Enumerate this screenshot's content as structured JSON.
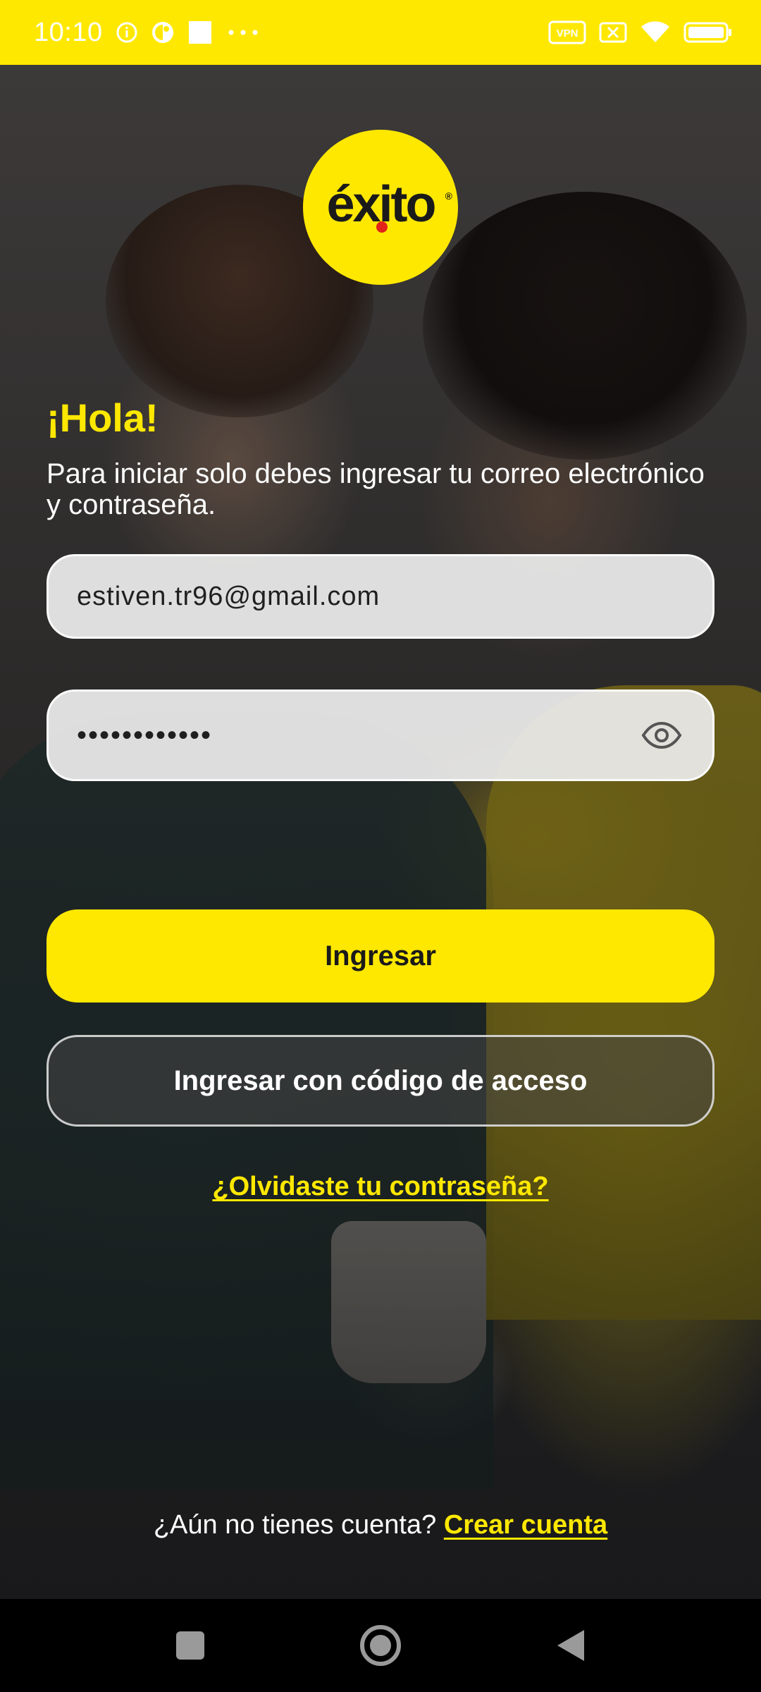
{
  "status_bar": {
    "time": "10:10",
    "icons": [
      "info-icon",
      "app-icon",
      "square-icon",
      "more-dots-icon",
      "vpn-icon",
      "sim-icon",
      "wifi-icon",
      "battery-icon"
    ],
    "vpn_label": "VPN"
  },
  "logo": {
    "text": "éxito",
    "registered": "®"
  },
  "greeting": "¡Hola!",
  "subtitle": "Para iniciar solo debes ingresar tu correo electrónico y contraseña.",
  "email": {
    "value": "estiven.tr96@gmail.com"
  },
  "password": {
    "value": "••••••••••••"
  },
  "buttons": {
    "login": "Ingresar",
    "access_code": "Ingresar con código de acceso"
  },
  "links": {
    "forgot_password": "¿Olvidaste tu contraseña?",
    "no_account": "¿Aún no tienes cuenta?",
    "create_account": "Crear cuenta"
  },
  "colors": {
    "brand_yellow": "#FFE800",
    "text_dark": "#1a1a1a"
  }
}
